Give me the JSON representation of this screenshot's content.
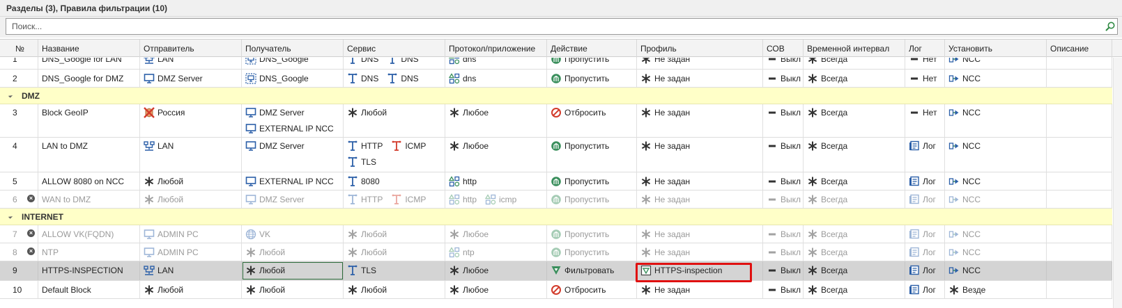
{
  "header": {
    "title": "Разделы (3), Правила фильтрации (10)"
  },
  "search": {
    "placeholder": "Поиск..."
  },
  "columns": [
    "№",
    "Название",
    "Отправитель",
    "Получатель",
    "Сервис",
    "Протокол/приложение",
    "Действие",
    "Профиль",
    "СОВ",
    "Временной интервал",
    "Лог",
    "Установить",
    "Описание"
  ],
  "sections": [
    {
      "label": "DMZ"
    },
    {
      "label": "INTERNET"
    }
  ],
  "rows": [
    {
      "num": "1",
      "name": "DNS_Google for LAN",
      "sender": [
        {
          "icon": "network",
          "text": "LAN"
        }
      ],
      "receiver": [
        {
          "icon": "dns-group",
          "text": "DNS_Google"
        }
      ],
      "service": [
        {
          "icon": "service",
          "text": "DNS"
        },
        {
          "icon": "service",
          "text": "DNS"
        }
      ],
      "proto": [
        {
          "icon": "app",
          "text": "dns"
        }
      ],
      "action": {
        "icon": "pass",
        "text": "Пропустить"
      },
      "profile": {
        "icon": "star",
        "text": "Не задан"
      },
      "ids": "Выкл",
      "time": "Всегда",
      "log": {
        "icon": "dash",
        "text": "Нет"
      },
      "install": {
        "icon": "install",
        "text": "NCC"
      }
    },
    {
      "num": "2",
      "name": "DNS_Google for DMZ",
      "sender": [
        {
          "icon": "monitor",
          "text": "DMZ Server"
        }
      ],
      "receiver": [
        {
          "icon": "dns-group",
          "text": "DNS_Google"
        }
      ],
      "service": [
        {
          "icon": "service",
          "text": "DNS"
        },
        {
          "icon": "service",
          "text": "DNS"
        }
      ],
      "proto": [
        {
          "icon": "app",
          "text": "dns"
        }
      ],
      "action": {
        "icon": "pass",
        "text": "Пропустить"
      },
      "profile": {
        "icon": "star",
        "text": "Не задан"
      },
      "ids": "Выкл",
      "time": "Всегда",
      "log": {
        "icon": "dash",
        "text": "Нет"
      },
      "install": {
        "icon": "install",
        "text": "NCC"
      }
    },
    {
      "num": "3",
      "name": "Block GeoIP",
      "sender": [
        {
          "icon": "geo",
          "text": "Россия"
        }
      ],
      "receiver": [
        {
          "icon": "monitor",
          "text": "DMZ Server"
        },
        {
          "icon": "monitor",
          "text": "EXTERNAL IP NCC"
        }
      ],
      "service": [
        {
          "icon": "star",
          "text": "Любой"
        }
      ],
      "proto": [
        {
          "icon": "star",
          "text": "Любое"
        }
      ],
      "action": {
        "icon": "drop",
        "text": "Отбросить"
      },
      "profile": {
        "icon": "star",
        "text": "Не задан"
      },
      "ids": "Выкл",
      "time": "Всегда",
      "log": {
        "icon": "dash",
        "text": "Нет"
      },
      "install": {
        "icon": "install",
        "text": "NCC"
      }
    },
    {
      "num": "4",
      "name": "LAN to DMZ",
      "sender": [
        {
          "icon": "network",
          "text": "LAN"
        }
      ],
      "receiver": [
        {
          "icon": "monitor",
          "text": "DMZ Server"
        }
      ],
      "service": [
        {
          "icon": "service",
          "text": "HTTP"
        },
        {
          "icon": "service-red",
          "text": "ICMP"
        },
        {
          "icon": "service",
          "text": "TLS"
        }
      ],
      "proto": [
        {
          "icon": "star",
          "text": "Любое"
        }
      ],
      "action": {
        "icon": "pass",
        "text": "Пропустить"
      },
      "profile": {
        "icon": "star",
        "text": "Не задан"
      },
      "ids": "Выкл",
      "time": "Всегда",
      "log": {
        "icon": "log",
        "text": "Лог"
      },
      "install": {
        "icon": "install",
        "text": "NCC"
      }
    },
    {
      "num": "5",
      "name": "ALLOW 8080 on NCC",
      "sender": [
        {
          "icon": "star",
          "text": "Любой"
        }
      ],
      "receiver": [
        {
          "icon": "monitor",
          "text": "EXTERNAL IP NCC"
        }
      ],
      "service": [
        {
          "icon": "service",
          "text": "8080"
        }
      ],
      "proto": [
        {
          "icon": "app",
          "text": "http"
        }
      ],
      "action": {
        "icon": "pass",
        "text": "Пропустить"
      },
      "profile": {
        "icon": "star",
        "text": "Не задан"
      },
      "ids": "Выкл",
      "time": "Всегда",
      "log": {
        "icon": "log",
        "text": "Лог"
      },
      "install": {
        "icon": "install",
        "text": "NCC"
      }
    },
    {
      "num": "6",
      "name": "WAN to DMZ",
      "sender": [
        {
          "icon": "star",
          "text": "Любой"
        }
      ],
      "receiver": [
        {
          "icon": "monitor",
          "text": "DMZ Server"
        }
      ],
      "service": [
        {
          "icon": "service",
          "text": "HTTP"
        },
        {
          "icon": "service-red",
          "text": "ICMP"
        }
      ],
      "proto": [
        {
          "icon": "app",
          "text": "http"
        },
        {
          "icon": "app",
          "text": "icmp"
        }
      ],
      "action": {
        "icon": "pass",
        "text": "Пропустить"
      },
      "profile": {
        "icon": "star",
        "text": "Не задан"
      },
      "ids": "Выкл",
      "time": "Всегда",
      "log": {
        "icon": "log",
        "text": "Лог"
      },
      "install": {
        "icon": "install",
        "text": "NCC"
      }
    },
    {
      "num": "7",
      "name": "ALLOW VK(FQDN)",
      "sender": [
        {
          "icon": "monitor",
          "text": "ADMIN PC"
        }
      ],
      "receiver": [
        {
          "icon": "globe",
          "text": "VK"
        }
      ],
      "service": [
        {
          "icon": "star",
          "text": "Любой"
        }
      ],
      "proto": [
        {
          "icon": "star",
          "text": "Любое"
        }
      ],
      "action": {
        "icon": "pass",
        "text": "Пропустить"
      },
      "profile": {
        "icon": "star",
        "text": "Не задан"
      },
      "ids": "Выкл",
      "time": "Всегда",
      "log": {
        "icon": "log",
        "text": "Лог"
      },
      "install": {
        "icon": "install",
        "text": "NCC"
      }
    },
    {
      "num": "8",
      "name": "NTP",
      "sender": [
        {
          "icon": "monitor",
          "text": "ADMIN PC"
        }
      ],
      "receiver": [
        {
          "icon": "star",
          "text": "Любой"
        }
      ],
      "service": [
        {
          "icon": "star",
          "text": "Любой"
        }
      ],
      "proto": [
        {
          "icon": "app",
          "text": "ntp"
        }
      ],
      "action": {
        "icon": "pass",
        "text": "Пропустить"
      },
      "profile": {
        "icon": "star",
        "text": "Не задан"
      },
      "ids": "Выкл",
      "time": "Всегда",
      "log": {
        "icon": "log",
        "text": "Лог"
      },
      "install": {
        "icon": "install",
        "text": "NCC"
      }
    },
    {
      "num": "9",
      "name": "HTTPS-INSPECTION",
      "sender": [
        {
          "icon": "network",
          "text": "LAN"
        }
      ],
      "receiver": [
        {
          "icon": "star",
          "text": "Любой"
        }
      ],
      "service": [
        {
          "icon": "service",
          "text": "TLS"
        }
      ],
      "proto": [
        {
          "icon": "star",
          "text": "Любое"
        }
      ],
      "action": {
        "icon": "filter",
        "text": "Фильтровать"
      },
      "profile": {
        "icon": "https-profile",
        "text": "HTTPS-inspection"
      },
      "ids": "Выкл",
      "time": "Всегда",
      "log": {
        "icon": "log",
        "text": "Лог"
      },
      "install": {
        "icon": "install",
        "text": "NCC"
      }
    },
    {
      "num": "10",
      "name": "Default Block",
      "sender": [
        {
          "icon": "star",
          "text": "Любой"
        }
      ],
      "receiver": [
        {
          "icon": "star",
          "text": "Любой"
        }
      ],
      "service": [
        {
          "icon": "star",
          "text": "Любой"
        }
      ],
      "proto": [
        {
          "icon": "star",
          "text": "Любое"
        }
      ],
      "action": {
        "icon": "drop",
        "text": "Отбросить"
      },
      "profile": {
        "icon": "star",
        "text": "Не задан"
      },
      "ids": "Выкл",
      "time": "Всегда",
      "log": {
        "icon": "log",
        "text": "Лог"
      },
      "install": {
        "icon": "star",
        "text": "Везде"
      }
    }
  ],
  "disabled_rows": [
    "6",
    "7",
    "8"
  ],
  "selected_row": "9",
  "colors": {
    "section_bg": "#ffffc8",
    "selected_bg": "#d4d4d4",
    "highlight_border": "#e01010",
    "icon_blue": "#2b5fa8",
    "icon_green": "#3a8f5c",
    "icon_red": "#d23b2b"
  }
}
